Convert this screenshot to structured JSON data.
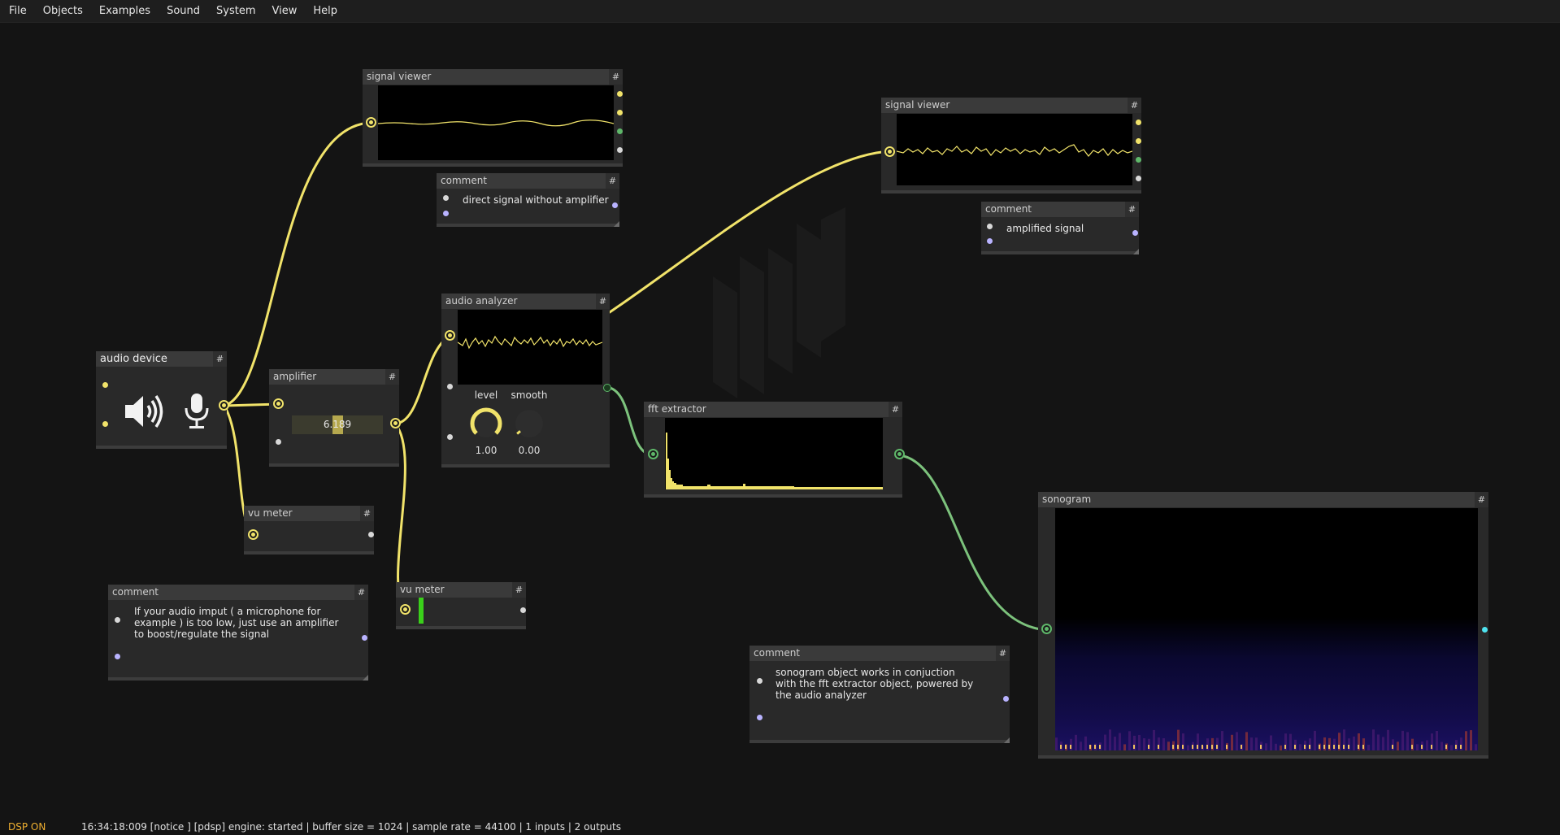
{
  "menu": [
    "File",
    "Objects",
    "Examples",
    "Sound",
    "System",
    "View",
    "Help"
  ],
  "status": {
    "dsp": "DSP ON",
    "log": "16:34:18:009 [notice ] [pdsp] engine: started | buffer size = 1024 | sample rate = 44100 | 1 inputs | 2 outputs"
  },
  "hash_symbol": "#",
  "nodes": {
    "signal_viewer_1": {
      "title": "signal viewer"
    },
    "signal_viewer_2": {
      "title": "signal viewer"
    },
    "comment_direct": {
      "title": "comment",
      "text": "direct signal without amplifier"
    },
    "comment_amplified": {
      "title": "comment",
      "text": "amplified signal"
    },
    "audio_analyzer": {
      "title": "audio analyzer",
      "level_label": "level",
      "level_value": "1.00",
      "level_fraction": 1.0,
      "smooth_label": "smooth",
      "smooth_value": "0.00",
      "smooth_fraction": 0.0
    },
    "audio_device": {
      "title": "audio device",
      "speaker_icon": "speaker-icon",
      "mic_icon": "microphone-icon"
    },
    "amplifier": {
      "title": "amplifier",
      "value": "6.189"
    },
    "fft_extractor": {
      "title": "fft extractor"
    },
    "vu_meter_1": {
      "title": "vu meter"
    },
    "vu_meter_2": {
      "title": "vu meter"
    },
    "comment_boost": {
      "title": "comment",
      "lines": [
        "If your audio imput ( a microphone for",
        "example ) is too low, just use an amplifier",
        "to boost/regulate the signal"
      ]
    },
    "comment_sonogram": {
      "title": "comment",
      "lines": [
        "sonogram object works in conjuction",
        "with the fft extractor object, powered by",
        "the audio analyzer"
      ]
    },
    "sonogram": {
      "title": "sonogram"
    }
  },
  "colors": {
    "background": "#141414",
    "node_body": "#292929",
    "node_header": "#3a3a3a",
    "audio_wire": "#f1e36a",
    "fft_wire": "#7cc27c",
    "dsp_status": "#f0b030",
    "vu_level": "#3ad01a"
  }
}
